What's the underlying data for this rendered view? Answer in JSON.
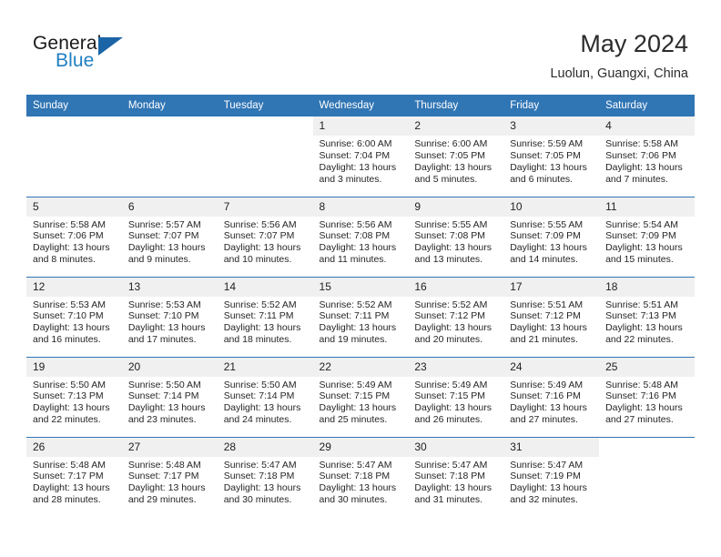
{
  "brand": {
    "name_top": "General",
    "name_bottom": "Blue",
    "accent_color": "#1f7fc4",
    "triangle_color": "#1b64a5"
  },
  "header": {
    "title": "May 2024",
    "subtitle": "Luolun, Guangxi, China"
  },
  "theme": {
    "header_row_bg": "#3075b4",
    "daynum_bg": "#f0f0f0",
    "grid_line": "#3075b4"
  },
  "calendar": {
    "weekday_headers": [
      "Sunday",
      "Monday",
      "Tuesday",
      "Wednesday",
      "Thursday",
      "Friday",
      "Saturday"
    ],
    "labels": {
      "sunrise": "Sunrise:",
      "sunset": "Sunset:",
      "daylight": "Daylight:"
    },
    "weeks": [
      [
        {
          "day": "",
          "empty": true
        },
        {
          "day": "",
          "empty": true
        },
        {
          "day": "",
          "empty": true
        },
        {
          "day": "1",
          "sunrise": "Sunrise: 6:00 AM",
          "sunset": "Sunset: 7:04 PM",
          "daylight1": "Daylight: 13 hours",
          "daylight2": "and 3 minutes."
        },
        {
          "day": "2",
          "sunrise": "Sunrise: 6:00 AM",
          "sunset": "Sunset: 7:05 PM",
          "daylight1": "Daylight: 13 hours",
          "daylight2": "and 5 minutes."
        },
        {
          "day": "3",
          "sunrise": "Sunrise: 5:59 AM",
          "sunset": "Sunset: 7:05 PM",
          "daylight1": "Daylight: 13 hours",
          "daylight2": "and 6 minutes."
        },
        {
          "day": "4",
          "sunrise": "Sunrise: 5:58 AM",
          "sunset": "Sunset: 7:06 PM",
          "daylight1": "Daylight: 13 hours",
          "daylight2": "and 7 minutes."
        }
      ],
      [
        {
          "day": "5",
          "sunrise": "Sunrise: 5:58 AM",
          "sunset": "Sunset: 7:06 PM",
          "daylight1": "Daylight: 13 hours",
          "daylight2": "and 8 minutes."
        },
        {
          "day": "6",
          "sunrise": "Sunrise: 5:57 AM",
          "sunset": "Sunset: 7:07 PM",
          "daylight1": "Daylight: 13 hours",
          "daylight2": "and 9 minutes."
        },
        {
          "day": "7",
          "sunrise": "Sunrise: 5:56 AM",
          "sunset": "Sunset: 7:07 PM",
          "daylight1": "Daylight: 13 hours",
          "daylight2": "and 10 minutes."
        },
        {
          "day": "8",
          "sunrise": "Sunrise: 5:56 AM",
          "sunset": "Sunset: 7:08 PM",
          "daylight1": "Daylight: 13 hours",
          "daylight2": "and 11 minutes."
        },
        {
          "day": "9",
          "sunrise": "Sunrise: 5:55 AM",
          "sunset": "Sunset: 7:08 PM",
          "daylight1": "Daylight: 13 hours",
          "daylight2": "and 13 minutes."
        },
        {
          "day": "10",
          "sunrise": "Sunrise: 5:55 AM",
          "sunset": "Sunset: 7:09 PM",
          "daylight1": "Daylight: 13 hours",
          "daylight2": "and 14 minutes."
        },
        {
          "day": "11",
          "sunrise": "Sunrise: 5:54 AM",
          "sunset": "Sunset: 7:09 PM",
          "daylight1": "Daylight: 13 hours",
          "daylight2": "and 15 minutes."
        }
      ],
      [
        {
          "day": "12",
          "sunrise": "Sunrise: 5:53 AM",
          "sunset": "Sunset: 7:10 PM",
          "daylight1": "Daylight: 13 hours",
          "daylight2": "and 16 minutes."
        },
        {
          "day": "13",
          "sunrise": "Sunrise: 5:53 AM",
          "sunset": "Sunset: 7:10 PM",
          "daylight1": "Daylight: 13 hours",
          "daylight2": "and 17 minutes."
        },
        {
          "day": "14",
          "sunrise": "Sunrise: 5:52 AM",
          "sunset": "Sunset: 7:11 PM",
          "daylight1": "Daylight: 13 hours",
          "daylight2": "and 18 minutes."
        },
        {
          "day": "15",
          "sunrise": "Sunrise: 5:52 AM",
          "sunset": "Sunset: 7:11 PM",
          "daylight1": "Daylight: 13 hours",
          "daylight2": "and 19 minutes."
        },
        {
          "day": "16",
          "sunrise": "Sunrise: 5:52 AM",
          "sunset": "Sunset: 7:12 PM",
          "daylight1": "Daylight: 13 hours",
          "daylight2": "and 20 minutes."
        },
        {
          "day": "17",
          "sunrise": "Sunrise: 5:51 AM",
          "sunset": "Sunset: 7:12 PM",
          "daylight1": "Daylight: 13 hours",
          "daylight2": "and 21 minutes."
        },
        {
          "day": "18",
          "sunrise": "Sunrise: 5:51 AM",
          "sunset": "Sunset: 7:13 PM",
          "daylight1": "Daylight: 13 hours",
          "daylight2": "and 22 minutes."
        }
      ],
      [
        {
          "day": "19",
          "sunrise": "Sunrise: 5:50 AM",
          "sunset": "Sunset: 7:13 PM",
          "daylight1": "Daylight: 13 hours",
          "daylight2": "and 22 minutes."
        },
        {
          "day": "20",
          "sunrise": "Sunrise: 5:50 AM",
          "sunset": "Sunset: 7:14 PM",
          "daylight1": "Daylight: 13 hours",
          "daylight2": "and 23 minutes."
        },
        {
          "day": "21",
          "sunrise": "Sunrise: 5:50 AM",
          "sunset": "Sunset: 7:14 PM",
          "daylight1": "Daylight: 13 hours",
          "daylight2": "and 24 minutes."
        },
        {
          "day": "22",
          "sunrise": "Sunrise: 5:49 AM",
          "sunset": "Sunset: 7:15 PM",
          "daylight1": "Daylight: 13 hours",
          "daylight2": "and 25 minutes."
        },
        {
          "day": "23",
          "sunrise": "Sunrise: 5:49 AM",
          "sunset": "Sunset: 7:15 PM",
          "daylight1": "Daylight: 13 hours",
          "daylight2": "and 26 minutes."
        },
        {
          "day": "24",
          "sunrise": "Sunrise: 5:49 AM",
          "sunset": "Sunset: 7:16 PM",
          "daylight1": "Daylight: 13 hours",
          "daylight2": "and 27 minutes."
        },
        {
          "day": "25",
          "sunrise": "Sunrise: 5:48 AM",
          "sunset": "Sunset: 7:16 PM",
          "daylight1": "Daylight: 13 hours",
          "daylight2": "and 27 minutes."
        }
      ],
      [
        {
          "day": "26",
          "sunrise": "Sunrise: 5:48 AM",
          "sunset": "Sunset: 7:17 PM",
          "daylight1": "Daylight: 13 hours",
          "daylight2": "and 28 minutes."
        },
        {
          "day": "27",
          "sunrise": "Sunrise: 5:48 AM",
          "sunset": "Sunset: 7:17 PM",
          "daylight1": "Daylight: 13 hours",
          "daylight2": "and 29 minutes."
        },
        {
          "day": "28",
          "sunrise": "Sunrise: 5:47 AM",
          "sunset": "Sunset: 7:18 PM",
          "daylight1": "Daylight: 13 hours",
          "daylight2": "and 30 minutes."
        },
        {
          "day": "29",
          "sunrise": "Sunrise: 5:47 AM",
          "sunset": "Sunset: 7:18 PM",
          "daylight1": "Daylight: 13 hours",
          "daylight2": "and 30 minutes."
        },
        {
          "day": "30",
          "sunrise": "Sunrise: 5:47 AM",
          "sunset": "Sunset: 7:18 PM",
          "daylight1": "Daylight: 13 hours",
          "daylight2": "and 31 minutes."
        },
        {
          "day": "31",
          "sunrise": "Sunrise: 5:47 AM",
          "sunset": "Sunset: 7:19 PM",
          "daylight1": "Daylight: 13 hours",
          "daylight2": "and 32 minutes."
        },
        {
          "day": "",
          "empty": true
        }
      ]
    ]
  }
}
